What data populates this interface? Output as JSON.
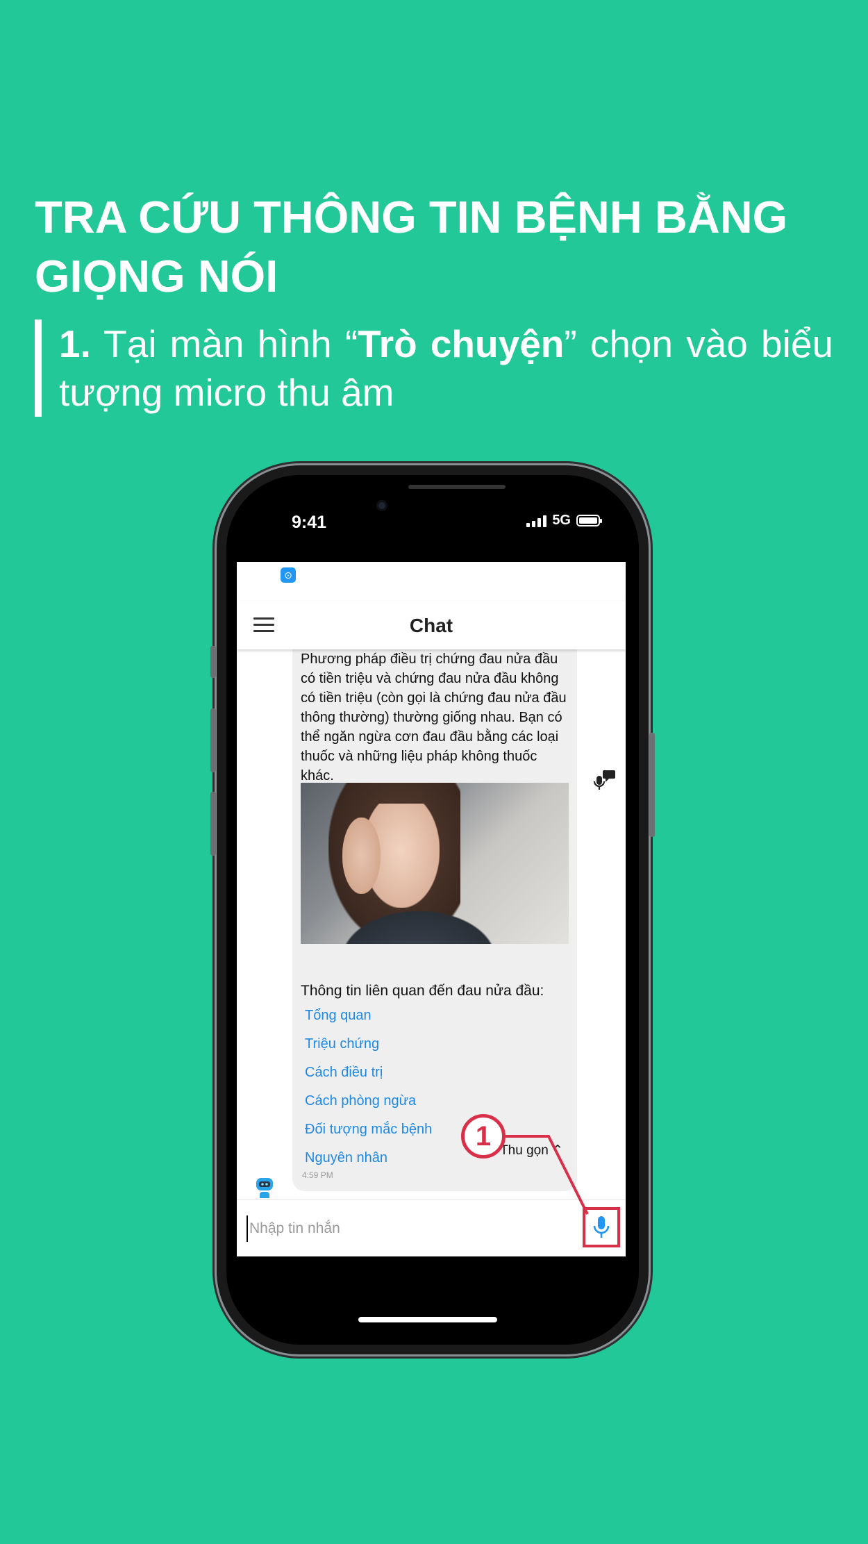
{
  "heading": {
    "title": "TRA CỨU THÔNG TIN BỆNH BẰNG GIỌNG NÓI",
    "step_number": "1.",
    "step_prefix": "Tại màn hình “",
    "step_bold": "Trò chuyện",
    "step_suffix": "” chọn vào biểu tượng micro thu âm"
  },
  "phone_status": {
    "time": "9:41",
    "network": "5G"
  },
  "app": {
    "title": "Chat",
    "message_text": "Phương pháp điều trị chứng đau nửa đầu có tiền triệu và chứng đau nửa đầu không có tiền triệu (còn gọi là chứng đau nửa đầu thông thường) thường giống nhau. Bạn có thể ngăn ngừa cơn đau đầu bằng các loại thuốc và những liệu pháp không thuốc khác.",
    "related_label": "Thông tin liên quan đến đau nửa đầu:",
    "related_links": [
      "Tổng quan",
      "Triệu chứng",
      "Cách điều trị",
      "Cách phòng ngừa",
      "Đối tượng mắc bệnh",
      "Nguyên nhân"
    ],
    "collapse_label": "Thu gọn",
    "message_time": "4:59 PM",
    "input_placeholder": "Nhập tin nhắn"
  },
  "annotation": {
    "callout_number": "1"
  },
  "colors": {
    "background": "#22c897",
    "link": "#1e88e5",
    "highlight": "#d9304a"
  },
  "icons": [
    "menu-icon",
    "mic-icon",
    "voice-feedback-icon",
    "bot-avatar-icon",
    "signal-icon",
    "battery-icon",
    "notification-icon"
  ]
}
